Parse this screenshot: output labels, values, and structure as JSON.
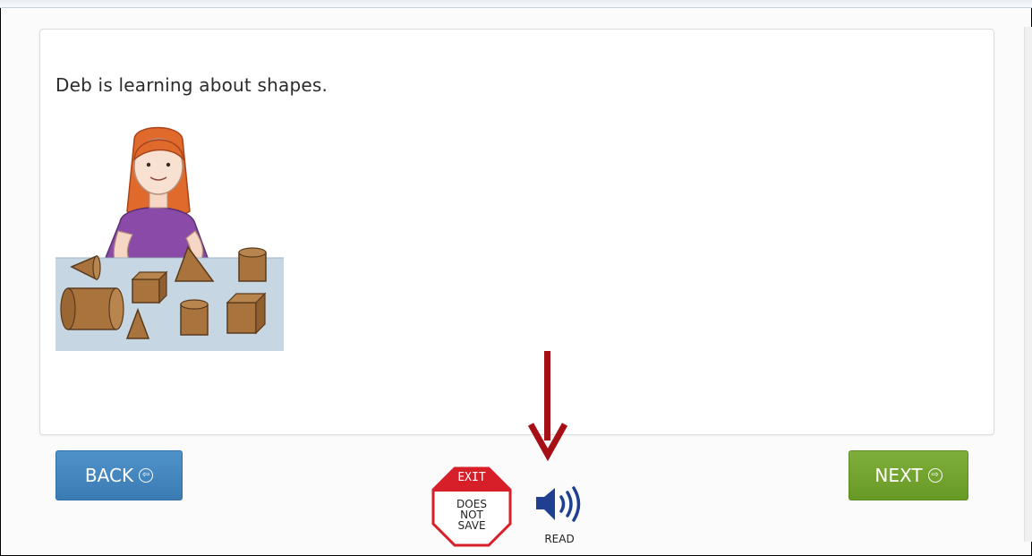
{
  "question": {
    "text": "Deb is learning about shapes."
  },
  "illustration": {
    "name": "girl-with-3d-shapes"
  },
  "nav": {
    "back_label": "BACK",
    "next_label": "NEXT",
    "back_color": "#3b7bb4",
    "next_color": "#679a25"
  },
  "exit": {
    "title": "EXIT",
    "lines": [
      "DOES",
      "NOT",
      "SAVE"
    ],
    "color": "#d71f2a"
  },
  "read": {
    "label": "READ",
    "icon": "speaker-icon",
    "color": "#1f3f91"
  },
  "annotation": {
    "icon": "down-arrow-icon",
    "color": "#a50f15"
  }
}
